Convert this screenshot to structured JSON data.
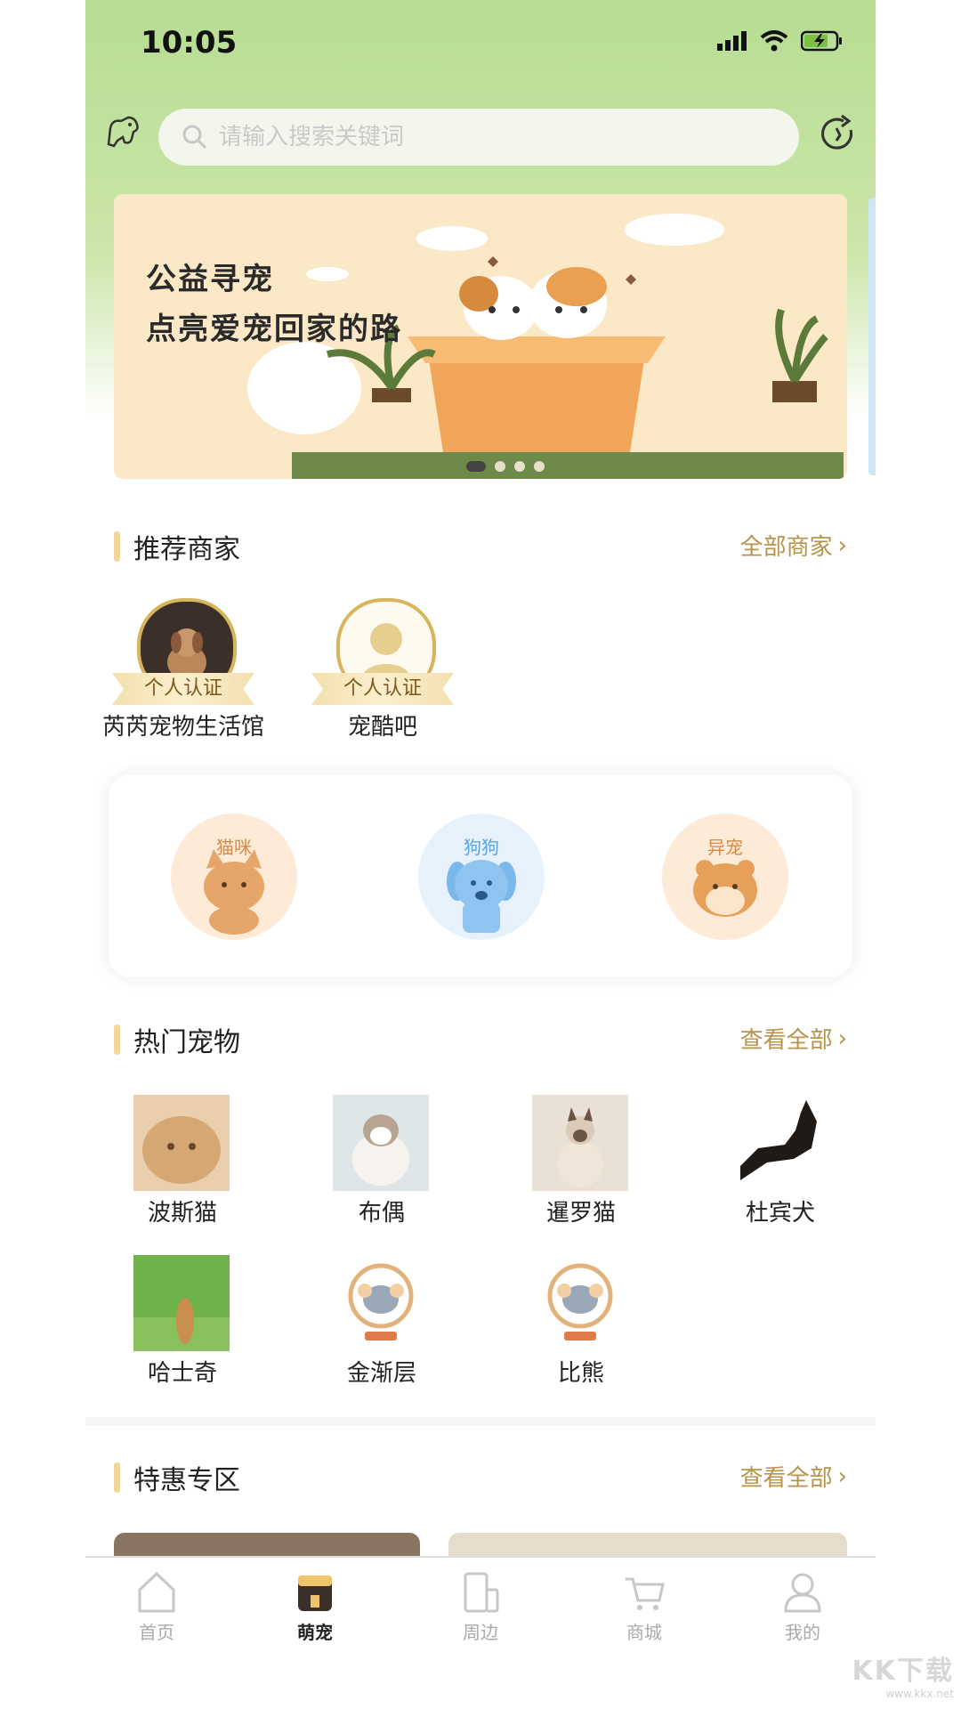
{
  "status": {
    "time": "10:05"
  },
  "search": {
    "placeholder": "请输入搜索关键词"
  },
  "banner": {
    "line1": "公益寻宠",
    "line2": "点亮爱宠回家的路"
  },
  "merchants": {
    "title": "推荐商家",
    "more": "全部商家",
    "items": [
      {
        "badge": "个人认证",
        "name": "芮芮宠物生活馆"
      },
      {
        "badge": "个人认证",
        "name": "宠酷吧"
      }
    ]
  },
  "categories": [
    {
      "label": "猫咪",
      "color": "#e6a66a"
    },
    {
      "label": "狗狗",
      "color": "#7ab8ea"
    },
    {
      "label": "异宠",
      "color": "#e6a05a"
    }
  ],
  "hot": {
    "title": "热门宠物",
    "more": "查看全部",
    "items": [
      {
        "name": "波斯猫"
      },
      {
        "name": "布偶"
      },
      {
        "name": "暹罗猫"
      },
      {
        "name": "杜宾犬"
      },
      {
        "name": "哈士奇"
      },
      {
        "name": "金渐层"
      },
      {
        "name": "比熊"
      }
    ]
  },
  "deals": {
    "title": "特惠专区",
    "more": "查看全部"
  },
  "tabs": [
    {
      "label": "首页"
    },
    {
      "label": "萌宠"
    },
    {
      "label": "周边"
    },
    {
      "label": "商城"
    },
    {
      "label": "我的"
    }
  ],
  "watermark": {
    "main": "KK下载",
    "sub": "www.kkx.net"
  },
  "colors": {
    "accent": "#b8934a",
    "headerGreen": "#b7dc93",
    "sectionBar": "#f2d79b"
  }
}
